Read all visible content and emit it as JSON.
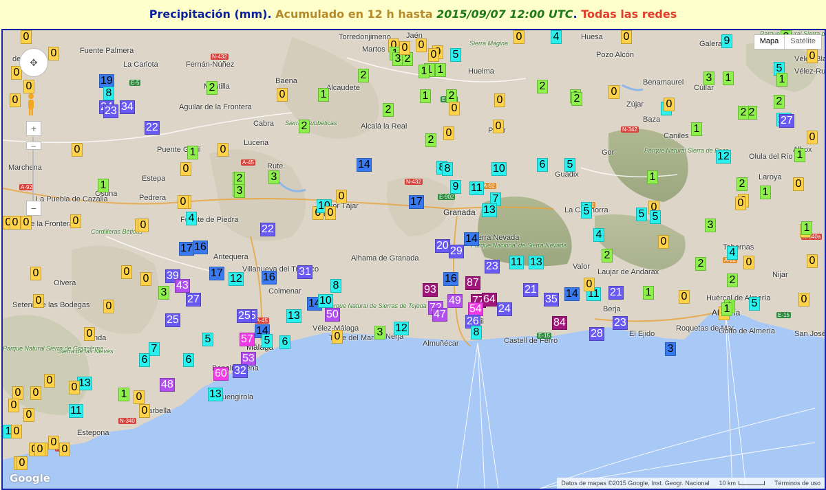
{
  "header": {
    "part1": "Precipitación (mm)",
    "sep1": ". ",
    "part2": "Acumulado en 12 h hasta ",
    "part3": "2015/09/07 12:00 UTC",
    "sep2": ". ",
    "part4": "Todas las redes"
  },
  "controls": {
    "pan_icon": "pan-control-icon",
    "pegman_icon": "pegman-icon",
    "zoom_in": "+",
    "zoom_out": "−",
    "zoom_knob": "–",
    "map_type": [
      "Mapa",
      "Satélite"
    ]
  },
  "attribution": {
    "data": "Datos de mapas ©2015 Google, Inst. Geogr. Nacional",
    "scale": "10 km",
    "terms": "Términos de uso"
  },
  "logo": "Google",
  "colors": {
    "sea": "#a8c8f6",
    "land": "#ddd6c8",
    "border": "#1622a8",
    "bins": [
      "#ffd24a",
      "#8ef04a",
      "#2af0ee",
      "#3a7af0",
      "#6a5af4",
      "#b34ef0",
      "#f03ce6",
      "#a0157a"
    ]
  },
  "places": [
    {
      "text": "Torredonjimeno",
      "cls": ""
    },
    {
      "text": "Jaén",
      "cls": ""
    },
    {
      "text": "Huesa",
      "cls": ""
    },
    {
      "text": "Martos",
      "cls": ""
    },
    {
      "text": "Sierra Mágina",
      "cls": "pk"
    },
    {
      "text": "Pozo Alcón",
      "cls": ""
    },
    {
      "text": "Fuente Palmera",
      "cls": ""
    },
    {
      "text": "Galera",
      "cls": ""
    },
    {
      "text": "Parque Natural Sierra de Castril",
      "cls": "pk"
    },
    {
      "text": "La Carlota",
      "cls": ""
    },
    {
      "text": "Fernán-Núñez",
      "cls": ""
    },
    {
      "text": "Baena",
      "cls": ""
    },
    {
      "text": "Alcaudete",
      "cls": ""
    },
    {
      "text": "Huelma",
      "cls": ""
    },
    {
      "text": "Benamaurel",
      "cls": ""
    },
    {
      "text": "Cúllar",
      "cls": ""
    },
    {
      "text": "Vélez-Blanco",
      "cls": ""
    },
    {
      "text": "Vélez-Rubio",
      "cls": ""
    },
    {
      "text": "Montilla",
      "cls": ""
    },
    {
      "text": "Zújar",
      "cls": ""
    },
    {
      "text": "Aguilar de la Frontera",
      "cls": ""
    },
    {
      "text": "Cabra",
      "cls": ""
    },
    {
      "text": "Sierras Subbéticas",
      "cls": "pk"
    },
    {
      "text": "Alcalá la Real",
      "cls": ""
    },
    {
      "text": "Pinar",
      "cls": ""
    },
    {
      "text": "Baza",
      "cls": ""
    },
    {
      "text": "Caniles",
      "cls": ""
    },
    {
      "text": "Lucena",
      "cls": ""
    },
    {
      "text": "Parque Natural Sierra de Baza",
      "cls": "pk"
    },
    {
      "text": "Puente Genil",
      "cls": ""
    },
    {
      "text": "Marchena",
      "cls": ""
    },
    {
      "text": "Albox",
      "cls": ""
    },
    {
      "text": "Rute",
      "cls": ""
    },
    {
      "text": "Estepa",
      "cls": ""
    },
    {
      "text": "Olula del Río",
      "cls": ""
    },
    {
      "text": "Gor",
      "cls": ""
    },
    {
      "text": "Guadix",
      "cls": ""
    },
    {
      "text": "La Puebla de Cazalla",
      "cls": ""
    },
    {
      "text": "Osuna",
      "cls": ""
    },
    {
      "text": "Laroya",
      "cls": ""
    },
    {
      "text": "Pedrera",
      "cls": ""
    },
    {
      "text": "Huétor Tájar",
      "cls": ""
    },
    {
      "text": "Loja",
      "cls": ""
    },
    {
      "text": "Granada",
      "cls": "big"
    },
    {
      "text": "La Calahorra",
      "cls": ""
    },
    {
      "text": "Fuente de Piedra",
      "cls": ""
    },
    {
      "text": "Morón de la Frontera",
      "cls": ""
    },
    {
      "text": "Sierra Nevada",
      "cls": ""
    },
    {
      "text": "Parque Nacional de Sierra Nevada",
      "cls": "pk"
    },
    {
      "text": "Cordilleras Béticas",
      "cls": "pk"
    },
    {
      "text": "Antequera",
      "cls": ""
    },
    {
      "text": "Villanueva del Trabuco",
      "cls": ""
    },
    {
      "text": "Tabernas",
      "cls": ""
    },
    {
      "text": "Alhama de Granada",
      "cls": ""
    },
    {
      "text": "Valor",
      "cls": ""
    },
    {
      "text": "Laujar de Andarax",
      "cls": ""
    },
    {
      "text": "Nijar",
      "cls": ""
    },
    {
      "text": "Olvera",
      "cls": ""
    },
    {
      "text": "Colmenar",
      "cls": ""
    },
    {
      "text": "Parque Natural de Sierras de Tejeda",
      "cls": "pk"
    },
    {
      "text": "Setenil de las Bodegas",
      "cls": ""
    },
    {
      "text": "Huércal de Almería",
      "cls": ""
    },
    {
      "text": "Almería",
      "cls": "big"
    },
    {
      "text": "Berja",
      "cls": ""
    },
    {
      "text": "Ronda",
      "cls": ""
    },
    {
      "text": "Vélez-Málaga",
      "cls": ""
    },
    {
      "text": "Torre del Mar",
      "cls": ""
    },
    {
      "text": "Nerja",
      "cls": ""
    },
    {
      "text": "Almuñécar",
      "cls": ""
    },
    {
      "text": "Motril",
      "cls": ""
    },
    {
      "text": "Castell de Ferro",
      "cls": ""
    },
    {
      "text": "El Ejido",
      "cls": ""
    },
    {
      "text": "Roquetas de Mar",
      "cls": ""
    },
    {
      "text": "Golfo de Almería",
      "cls": ""
    },
    {
      "text": "San José",
      "cls": ""
    },
    {
      "text": "Parque Natural Sierra de Grazalema",
      "cls": "pk"
    },
    {
      "text": "Sierra de las Nieves",
      "cls": "pk"
    },
    {
      "text": "Málaga",
      "cls": "big"
    },
    {
      "text": "Benalmádena",
      "cls": ""
    },
    {
      "text": "Fuengirola",
      "cls": ""
    },
    {
      "text": "Marbella",
      "cls": ""
    },
    {
      "text": "Estepona",
      "cls": ""
    },
    {
      "text": "La Carlota",
      "cls": ""
    },
    {
      "text": "del Río",
      "cls": ""
    }
  ],
  "roads": [
    "N-432",
    "E-5",
    "A-45",
    "E-902",
    "A-92",
    "N-342",
    "A-92",
    "E-902",
    "N-432",
    "A-92",
    "N-340a",
    "A-92",
    "A-45",
    "E-15",
    "N-340",
    "E-15",
    "AP-7"
  ],
  "stations": [
    {
      "v": "0",
      "c": 0
    },
    {
      "v": "0",
      "c": 0
    },
    {
      "v": "0",
      "c": 0
    },
    {
      "v": "0",
      "c": 0
    },
    {
      "v": "0",
      "c": 0
    },
    {
      "v": "19",
      "c": 3
    },
    {
      "v": "8",
      "c": 2
    },
    {
      "v": "2",
      "c": 1
    },
    {
      "v": "0",
      "c": 0
    },
    {
      "v": "1",
      "c": 1
    },
    {
      "v": "24",
      "c": 4
    },
    {
      "v": "23",
      "c": 4
    },
    {
      "v": "34",
      "c": 4
    },
    {
      "v": "22",
      "c": 4
    },
    {
      "v": "2",
      "c": 1
    },
    {
      "v": "0",
      "c": 0
    },
    {
      "v": "1",
      "c": 1
    },
    {
      "v": "0",
      "c": 0
    },
    {
      "v": "0",
      "c": 0
    },
    {
      "v": "2",
      "c": 1
    },
    {
      "v": "0",
      "c": 0
    },
    {
      "v": "1",
      "c": 1
    },
    {
      "v": "3",
      "c": 1
    },
    {
      "v": "0",
      "c": 0
    },
    {
      "v": "14",
      "c": 3
    },
    {
      "v": "0",
      "c": 0
    },
    {
      "v": "2",
      "c": 1
    },
    {
      "v": "3",
      "c": 1
    },
    {
      "v": "3",
      "c": 1
    },
    {
      "v": "0",
      "c": 0
    },
    {
      "v": "1",
      "c": 1
    },
    {
      "v": "0",
      "c": 0
    },
    {
      "v": "4",
      "c": 2
    },
    {
      "v": "0",
      "c": 0
    },
    {
      "v": "0",
      "c": 0
    },
    {
      "v": "0",
      "c": 0
    },
    {
      "v": "17",
      "c": 3
    },
    {
      "v": "16",
      "c": 3
    },
    {
      "v": "22",
      "c": 4
    },
    {
      "v": "0",
      "c": 0
    },
    {
      "v": "10",
      "c": 2
    },
    {
      "v": "0",
      "c": 0
    },
    {
      "v": "0",
      "c": 0
    },
    {
      "v": "0",
      "c": 0
    },
    {
      "v": "0",
      "c": 0
    },
    {
      "v": "39",
      "c": 4
    },
    {
      "v": "43",
      "c": 5
    },
    {
      "v": "3",
      "c": 1
    },
    {
      "v": "27",
      "c": 4
    },
    {
      "v": "17",
      "c": 3
    },
    {
      "v": "12",
      "c": 2
    },
    {
      "v": "16",
      "c": 3
    },
    {
      "v": "31",
      "c": 4
    },
    {
      "v": "25",
      "c": 4
    },
    {
      "v": "0",
      "c": 0
    },
    {
      "v": "0",
      "c": 0
    },
    {
      "v": "25",
      "c": 4
    },
    {
      "v": "0",
      "c": 0
    },
    {
      "v": "7",
      "c": 2
    },
    {
      "v": "6",
      "c": 2
    },
    {
      "v": "6",
      "c": 2
    },
    {
      "v": "5",
      "c": 2
    },
    {
      "v": "25",
      "c": 4
    },
    {
      "v": "14",
      "c": 3
    },
    {
      "v": "5",
      "c": 2
    },
    {
      "v": "8",
      "c": 2
    },
    {
      "v": "14",
      "c": 3
    },
    {
      "v": "10",
      "c": 2
    },
    {
      "v": "13",
      "c": 2
    },
    {
      "v": "50",
      "c": 5
    },
    {
      "v": "57",
      "c": 6
    },
    {
      "v": "53",
      "c": 5
    },
    {
      "v": "6",
      "c": 2
    },
    {
      "v": "32",
      "c": 4
    },
    {
      "v": "60",
      "c": 6
    },
    {
      "v": "48",
      "c": 5
    },
    {
      "v": "13",
      "c": 2
    },
    {
      "v": "0",
      "c": 0
    },
    {
      "v": "13",
      "c": 2
    },
    {
      "v": "0",
      "c": 0
    },
    {
      "v": "0",
      "c": 0
    },
    {
      "v": "0",
      "c": 0
    },
    {
      "v": "1",
      "c": 1
    },
    {
      "v": "0",
      "c": 0
    },
    {
      "v": "0",
      "c": 0
    },
    {
      "v": "11",
      "c": 2
    },
    {
      "v": "0",
      "c": 0
    },
    {
      "v": "0",
      "c": 0
    },
    {
      "v": "0",
      "c": 0
    },
    {
      "v": "0",
      "c": 0
    },
    {
      "v": "1",
      "c": 2
    },
    {
      "v": "0",
      "c": 0
    },
    {
      "v": "0",
      "c": 0
    },
    {
      "v": "0",
      "c": 0
    },
    {
      "v": "0",
      "c": 0
    },
    {
      "v": "0",
      "c": 0
    },
    {
      "v": "0",
      "c": 0
    },
    {
      "v": "3",
      "c": 1
    },
    {
      "v": "12",
      "c": 2
    },
    {
      "v": "0",
      "c": 0
    },
    {
      "v": "0",
      "c": 0
    },
    {
      "v": "1",
      "c": 1
    },
    {
      "v": "0",
      "c": 0
    },
    {
      "v": "3",
      "c": 1
    },
    {
      "v": "2",
      "c": 1
    },
    {
      "v": "0",
      "c": 0
    },
    {
      "v": "1",
      "c": 1
    },
    {
      "v": "5",
      "c": 2
    },
    {
      "v": "2",
      "c": 1
    },
    {
      "v": "0",
      "c": 0
    },
    {
      "v": "2",
      "c": 1
    },
    {
      "v": "2",
      "c": 1
    },
    {
      "v": "0",
      "c": 0
    },
    {
      "v": "2",
      "c": 1
    },
    {
      "v": "8",
      "c": 2
    },
    {
      "v": "8",
      "c": 2
    },
    {
      "v": "9",
      "c": 2
    },
    {
      "v": "11",
      "c": 2
    },
    {
      "v": "7",
      "c": 2
    },
    {
      "v": "13",
      "c": 2
    },
    {
      "v": "10",
      "c": 2
    },
    {
      "v": "6",
      "c": 2
    },
    {
      "v": "5",
      "c": 2
    },
    {
      "v": "17",
      "c": 3
    },
    {
      "v": "9",
      "c": 2
    },
    {
      "v": "20",
      "c": 4
    },
    {
      "v": "29",
      "c": 4
    },
    {
      "v": "14",
      "c": 3
    },
    {
      "v": "23",
      "c": 4
    },
    {
      "v": "11",
      "c": 2
    },
    {
      "v": "13",
      "c": 2
    },
    {
      "v": "16",
      "c": 3
    },
    {
      "v": "87",
      "c": 7
    },
    {
      "v": "93",
      "c": 7
    },
    {
      "v": "72",
      "c": 5
    },
    {
      "v": "49",
      "c": 5
    },
    {
      "v": "47",
      "c": 5
    },
    {
      "v": "77",
      "c": 7
    },
    {
      "v": "64",
      "c": 7
    },
    {
      "v": "54",
      "c": 6
    },
    {
      "v": "24",
      "c": 4
    },
    {
      "v": "21",
      "c": 4
    },
    {
      "v": "26",
      "c": 4
    },
    {
      "v": "8",
      "c": 2
    },
    {
      "v": "35",
      "c": 4
    },
    {
      "v": "14",
      "c": 3
    },
    {
      "v": "11",
      "c": 2
    },
    {
      "v": "21",
      "c": 4
    },
    {
      "v": "84",
      "c": 7
    },
    {
      "v": "28",
      "c": 4
    },
    {
      "v": "23",
      "c": 4
    },
    {
      "v": "1",
      "c": 1
    },
    {
      "v": "0",
      "c": 0
    },
    {
      "v": "1",
      "c": 1
    },
    {
      "v": "5",
      "c": 2
    },
    {
      "v": "3",
      "c": 3
    },
    {
      "v": "0",
      "c": 0
    },
    {
      "v": "0",
      "c": 0
    },
    {
      "v": "1",
      "c": 1
    },
    {
      "v": "0",
      "c": 0
    },
    {
      "v": "4",
      "c": 2
    },
    {
      "v": "0",
      "c": 0
    },
    {
      "v": "1",
      "c": 1
    },
    {
      "v": "0",
      "c": 0
    },
    {
      "v": "1",
      "c": 1
    },
    {
      "v": "6",
      "c": 2
    },
    {
      "v": "3",
      "c": 1
    },
    {
      "v": "5",
      "c": 2
    },
    {
      "v": "9",
      "c": 2
    },
    {
      "v": "10",
      "c": 2
    },
    {
      "v": "5",
      "c": 2
    },
    {
      "v": "5",
      "c": 2
    },
    {
      "v": "3",
      "c": 1
    },
    {
      "v": "5",
      "c": 2
    },
    {
      "v": "4",
      "c": 2
    },
    {
      "v": "2",
      "c": 1
    },
    {
      "v": "0",
      "c": 0
    },
    {
      "v": "0",
      "c": 0
    },
    {
      "v": "2",
      "c": 1
    },
    {
      "v": "2",
      "c": 1
    },
    {
      "v": "0",
      "c": 0
    },
    {
      "v": "1",
      "c": 1
    },
    {
      "v": "0",
      "c": 0
    },
    {
      "v": "2",
      "c": 1
    },
    {
      "v": "27",
      "c": 4
    },
    {
      "v": "12",
      "c": 2
    },
    {
      "v": "1",
      "c": 1
    },
    {
      "v": "2",
      "c": 1
    },
    {
      "v": "0",
      "c": 0
    },
    {
      "v": "4",
      "c": 2
    },
    {
      "v": "0",
      "c": 0
    },
    {
      "v": "2",
      "c": 1
    },
    {
      "v": "2",
      "c": 1
    },
    {
      "v": "0",
      "c": 0
    },
    {
      "v": "0",
      "c": 0
    },
    {
      "v": "1",
      "c": 1
    },
    {
      "v": "1",
      "c": 1
    },
    {
      "v": "0",
      "c": 0
    },
    {
      "v": "0",
      "c": 0
    },
    {
      "v": "0",
      "c": 0
    },
    {
      "v": "2",
      "c": 1
    },
    {
      "v": "2",
      "c": 1
    },
    {
      "v": "0",
      "c": 0
    },
    {
      "v": "1",
      "c": 1
    },
    {
      "v": "0",
      "c": 0
    },
    {
      "v": "1",
      "c": 1
    },
    {
      "v": "0",
      "c": 0
    },
    {
      "v": "3",
      "c": 1
    },
    {
      "v": "2",
      "c": 1
    },
    {
      "v": "0",
      "c": 0
    },
    {
      "v": "2",
      "c": 1
    },
    {
      "v": "1",
      "c": 1
    },
    {
      "v": "0",
      "c": 0
    },
    {
      "v": "1",
      "c": 1
    },
    {
      "v": "0",
      "c": 0
    }
  ]
}
